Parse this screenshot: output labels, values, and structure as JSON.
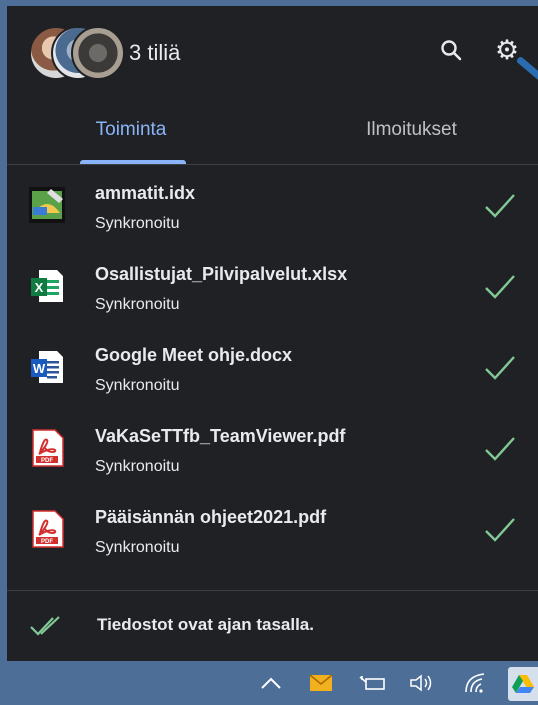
{
  "header": {
    "account_label": "3 tiliä"
  },
  "tabs": [
    {
      "label": "Toiminta",
      "active": true
    },
    {
      "label": "Ilmoitukset",
      "active": false
    }
  ],
  "files": [
    {
      "name": "ammatit.idx",
      "status": "Synkronoitu",
      "icon": "idx-file-icon"
    },
    {
      "name": "Osallistujat_Pilvipalvelut.xlsx",
      "status": "Synkronoitu",
      "icon": "excel-file-icon"
    },
    {
      "name": "Google Meet ohje.docx",
      "status": "Synkronoitu",
      "icon": "word-file-icon"
    },
    {
      "name": "VaKaSeTTfb_TeamViewer.pdf",
      "status": "Synkronoitu",
      "icon": "pdf-file-icon"
    },
    {
      "name": "Pääisännän ohjeet2021.pdf",
      "status": "Synkronoitu",
      "icon": "pdf-file-icon"
    }
  ],
  "footer": {
    "status_text": "Tiedostot ovat ajan tasalla."
  },
  "colors": {
    "panel_bg": "#202124",
    "accent": "#8ab4f8",
    "check": "#81c995",
    "taskbar": "#4d6e96"
  }
}
